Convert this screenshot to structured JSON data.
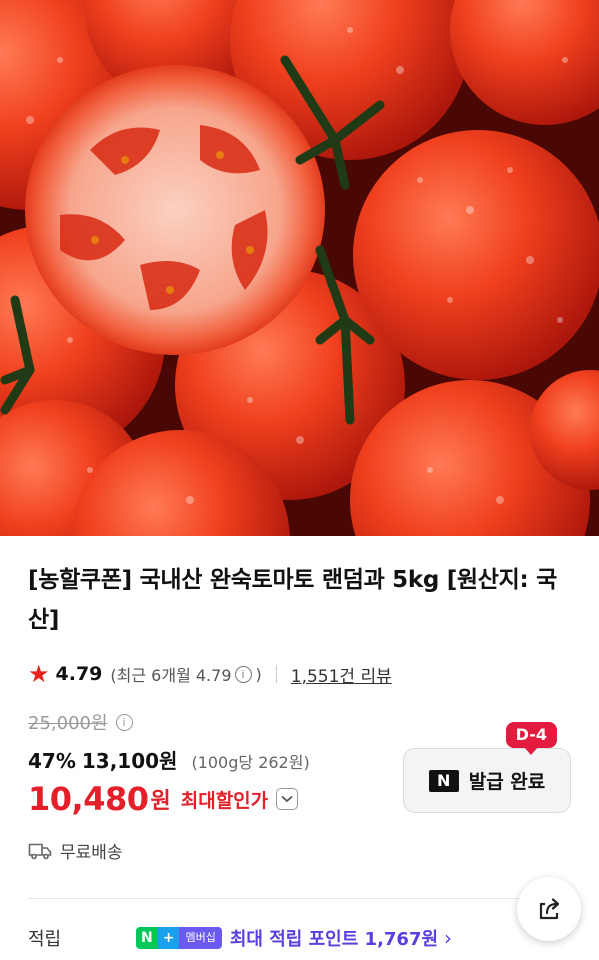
{
  "product": {
    "image_alt_icon": "tomato-photo",
    "title": "[농할쿠폰] 국내산 완숙토마토 랜덤과 5kg [원산지: 국산]"
  },
  "rating": {
    "score": "4.79",
    "recent": "(최근 6개월 4.79",
    "recent_close": ")",
    "reviews": "1,551건 리뷰"
  },
  "price": {
    "original": "25,000원",
    "discount_pct": "47%",
    "discount_price": "13,100원",
    "unit_price": "(100g당 262원)",
    "final_amount": "10,480",
    "final_currency": "원",
    "final_label": "최대할인가"
  },
  "coupon": {
    "dday": "D-4",
    "logo": "N",
    "label": "발급 완료"
  },
  "shipping": {
    "label": "무료배송"
  },
  "points": {
    "label": "적립",
    "badge_n": "N",
    "badge_plus": "+",
    "badge_text": "멤버십",
    "text": "최대 적립 포인트 1,767원"
  },
  "colors": {
    "accent_red": "#e3202a",
    "dday_red": "#e31b3f",
    "naver_green": "#03c75a",
    "membership_purple": "#5b3ee0"
  }
}
